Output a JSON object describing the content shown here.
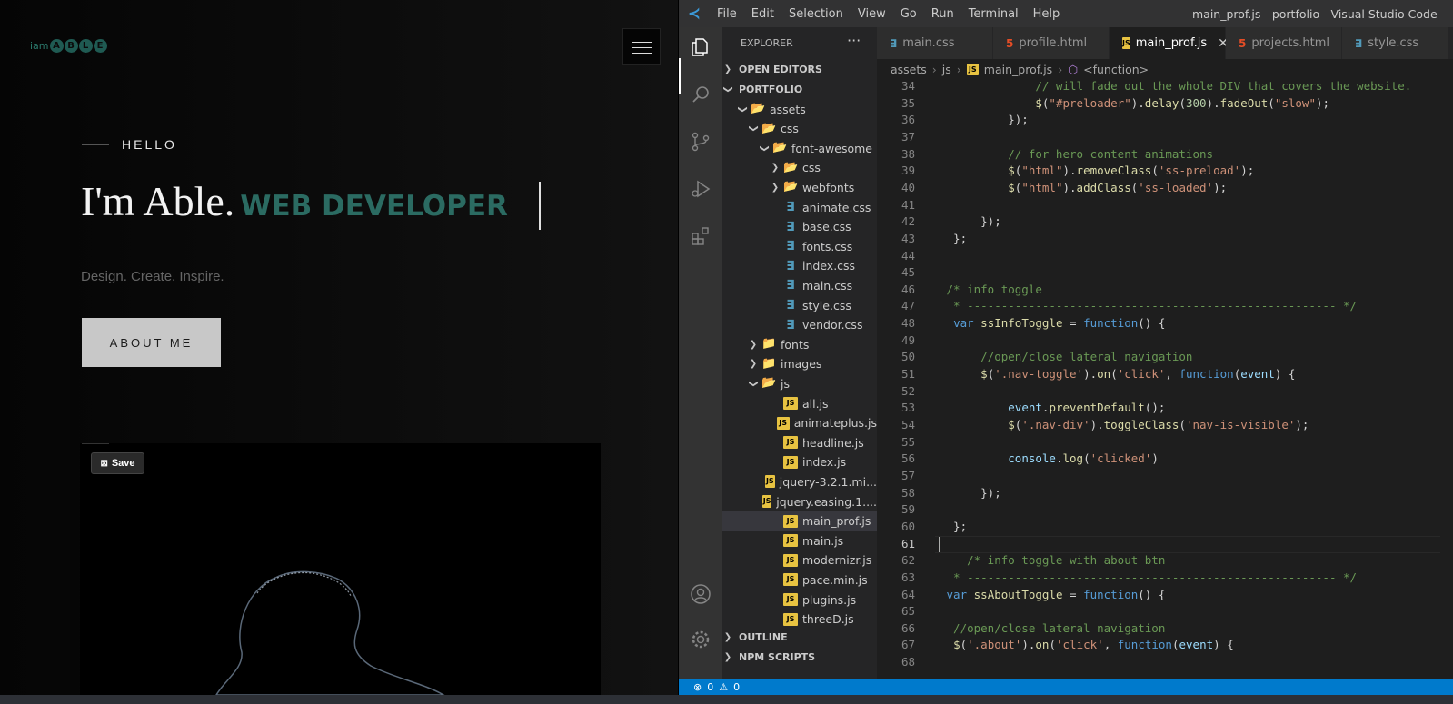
{
  "website": {
    "logo_prefix": "iam",
    "logo_letters": [
      "A",
      "B",
      "L",
      "E"
    ],
    "menu_icon": "hamburger-icon",
    "hello": "HELLO",
    "name": "I'm Able.",
    "role": "WEB DEVELOPER",
    "tagline": "Design. Create. Inspire.",
    "about_button": "ABOUT ME",
    "save_button": "Save",
    "accent_color": "#2b6b62"
  },
  "vscode": {
    "menu": [
      "File",
      "Edit",
      "Selection",
      "View",
      "Go",
      "Run",
      "Terminal",
      "Help"
    ],
    "window_title": "main_prof.js - portfolio - Visual Studio Code",
    "activity_icons": [
      "explorer-icon",
      "search-icon",
      "source-control-icon",
      "run-debug-icon",
      "extensions-icon",
      "account-icon",
      "settings-gear-icon"
    ],
    "sidebar": {
      "title": "EXPLORER",
      "more": "···",
      "sections": {
        "open_editors": "OPEN EDITORS",
        "portfolio": "PORTFOLIO",
        "outline": "OUTLINE",
        "npm": "NPM SCRIPTS"
      },
      "tree": [
        {
          "label": "assets",
          "kind": "folder",
          "depth": 1,
          "open": true
        },
        {
          "label": "css",
          "kind": "folder-blue",
          "depth": 2,
          "open": true
        },
        {
          "label": "font-awesome",
          "kind": "folder-plain",
          "depth": 3,
          "open": true
        },
        {
          "label": "css",
          "kind": "folder-blue",
          "depth": 4,
          "open": false
        },
        {
          "label": "webfonts",
          "kind": "folder-plain",
          "depth": 4,
          "open": false
        },
        {
          "label": "animate.css",
          "kind": "css",
          "depth": 4
        },
        {
          "label": "base.css",
          "kind": "css",
          "depth": 4
        },
        {
          "label": "fonts.css",
          "kind": "css",
          "depth": 4
        },
        {
          "label": "index.css",
          "kind": "css",
          "depth": 4
        },
        {
          "label": "main.css",
          "kind": "css",
          "depth": 4
        },
        {
          "label": "style.css",
          "kind": "css",
          "depth": 4
        },
        {
          "label": "vendor.css",
          "kind": "css",
          "depth": 4
        },
        {
          "label": "fonts",
          "kind": "folder-red",
          "depth": 2,
          "open": false
        },
        {
          "label": "images",
          "kind": "folder-green",
          "depth": 2,
          "open": false
        },
        {
          "label": "js",
          "kind": "folder",
          "depth": 2,
          "open": true
        },
        {
          "label": "all.js",
          "kind": "js",
          "depth": 4
        },
        {
          "label": "animateplus.js",
          "kind": "js",
          "depth": 4
        },
        {
          "label": "headline.js",
          "kind": "js",
          "depth": 4
        },
        {
          "label": "index.js",
          "kind": "js",
          "depth": 4
        },
        {
          "label": "jquery-3.2.1.mi...",
          "kind": "js",
          "depth": 4
        },
        {
          "label": "jquery.easing.1....",
          "kind": "js",
          "depth": 4
        },
        {
          "label": "main_prof.js",
          "kind": "js",
          "depth": 4,
          "selected": true
        },
        {
          "label": "main.js",
          "kind": "js",
          "depth": 4
        },
        {
          "label": "modernizr.js",
          "kind": "js",
          "depth": 4
        },
        {
          "label": "pace.min.js",
          "kind": "js",
          "depth": 4
        },
        {
          "label": "plugins.js",
          "kind": "js",
          "depth": 4
        },
        {
          "label": "threeD.js",
          "kind": "js",
          "depth": 4
        }
      ]
    },
    "tabs": [
      {
        "label": "main.css",
        "kind": "css"
      },
      {
        "label": "profile.html",
        "kind": "html"
      },
      {
        "label": "main_prof.js",
        "kind": "js",
        "active": true
      },
      {
        "label": "projects.html",
        "kind": "html"
      },
      {
        "label": "style.css",
        "kind": "css"
      }
    ],
    "breadcrumb": [
      "assets",
      "js",
      "main_prof.js",
      "<function>"
    ],
    "code": [
      {
        "n": "34",
        "t": "              // will fade out the whole DIV that covers the website."
      },
      {
        "n": "35",
        "t": "              $(\"#preloader\").delay(300).fadeOut(\"slow\");"
      },
      {
        "n": "36",
        "t": "          });"
      },
      {
        "n": "37",
        "t": ""
      },
      {
        "n": "38",
        "t": "          // for hero content animations"
      },
      {
        "n": "39",
        "t": "          $(\"html\").removeClass('ss-preload');"
      },
      {
        "n": "40",
        "t": "          $(\"html\").addClass('ss-loaded');"
      },
      {
        "n": "41",
        "t": ""
      },
      {
        "n": "42",
        "t": "      });"
      },
      {
        "n": "43",
        "t": "  };"
      },
      {
        "n": "44",
        "t": ""
      },
      {
        "n": "45",
        "t": ""
      },
      {
        "n": "46",
        "t": " /* info toggle"
      },
      {
        "n": "47",
        "t": "  * ------------------------------------------------------ */"
      },
      {
        "n": "48",
        "t": "  var ssInfoToggle = function() {"
      },
      {
        "n": "49",
        "t": ""
      },
      {
        "n": "50",
        "t": "      //open/close lateral navigation"
      },
      {
        "n": "51",
        "t": "      $('.nav-toggle').on('click', function(event) {"
      },
      {
        "n": "52",
        "t": ""
      },
      {
        "n": "53",
        "t": "          event.preventDefault();"
      },
      {
        "n": "54",
        "t": "          $('.nav-div').toggleClass('nav-is-visible');"
      },
      {
        "n": "55",
        "t": ""
      },
      {
        "n": "56",
        "t": "          console.log('clicked')"
      },
      {
        "n": "57",
        "t": ""
      },
      {
        "n": "58",
        "t": "      });"
      },
      {
        "n": "59",
        "t": ""
      },
      {
        "n": "60",
        "t": "  };"
      },
      {
        "n": "61",
        "t": ""
      },
      {
        "n": "62",
        "t": "    /* info toggle with about btn"
      },
      {
        "n": "63",
        "t": "  * ------------------------------------------------------ */"
      },
      {
        "n": "64",
        "t": " var ssAboutToggle = function() {"
      },
      {
        "n": "65",
        "t": ""
      },
      {
        "n": "66",
        "t": "  //open/close lateral navigation"
      },
      {
        "n": "67",
        "t": "  $('.about').on('click', function(event) {"
      },
      {
        "n": "68",
        "t": ""
      }
    ],
    "current_line": "61",
    "status": {
      "errors": "0",
      "warnings": "0"
    }
  }
}
